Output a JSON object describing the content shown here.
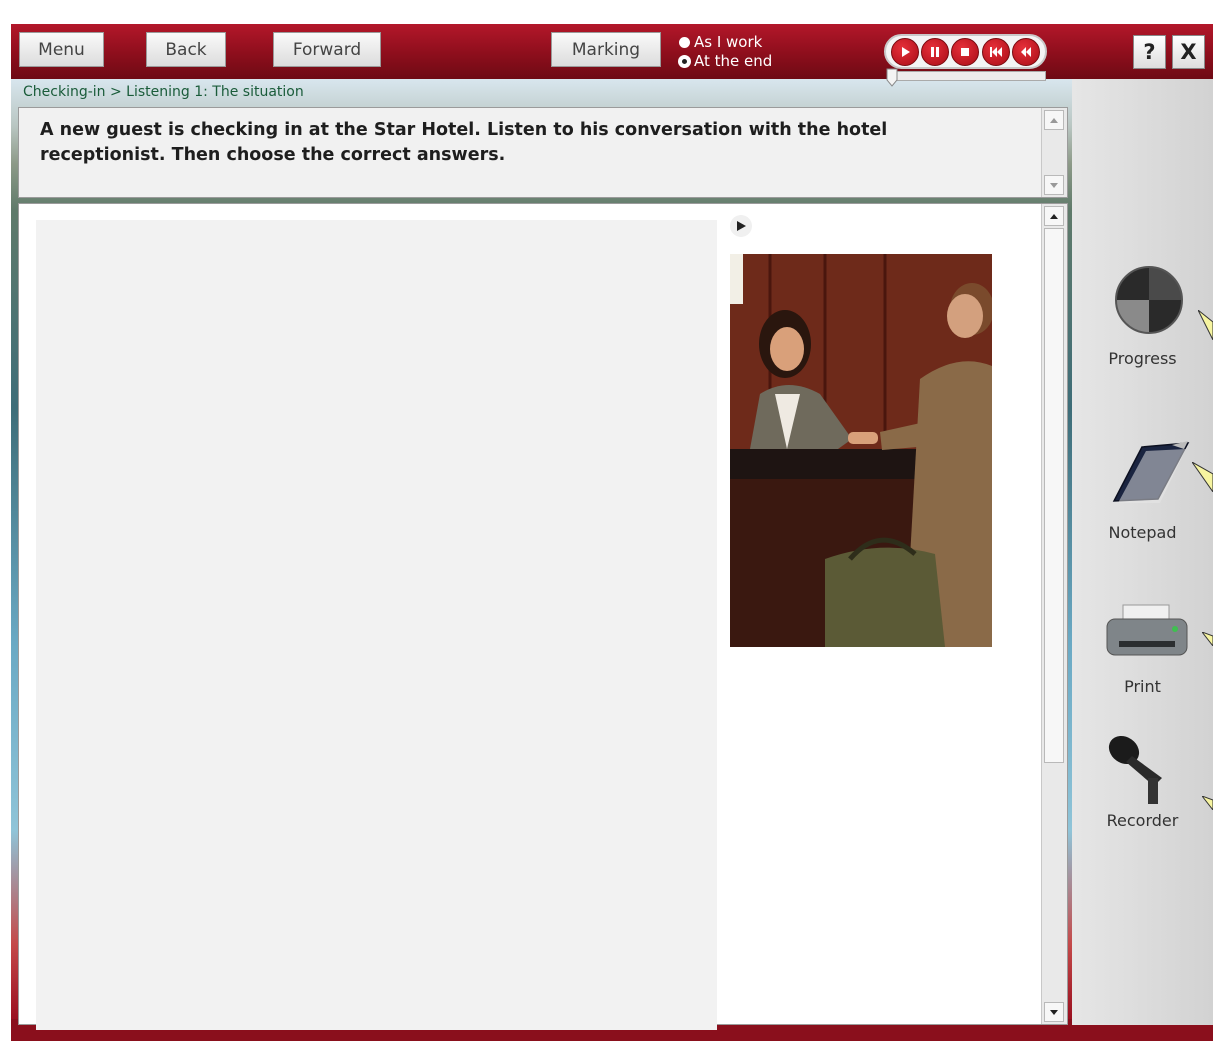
{
  "toolbar": {
    "menu_label": "Menu",
    "back_label": "Back",
    "forward_label": "Forward",
    "marking_label": "Marking",
    "marking_options": [
      {
        "label": "As I work",
        "selected": false
      },
      {
        "label": "At the end",
        "selected": true
      }
    ],
    "media_controls": [
      "play-icon",
      "pause-icon",
      "stop-icon",
      "rewind-icon",
      "skip-back-icon"
    ],
    "help_label": "?",
    "close_label": "X"
  },
  "breadcrumb": "Checking-in > Listening 1: The situation",
  "instructions": "A new guest is checking in at the Star Hotel. Listen to his conversation with the hotel receptionist. Then choose the correct answers.",
  "sidebar": {
    "progress_label": "Progress",
    "notepad_label": "Notepad",
    "print_label": "Print",
    "recorder_label": "Recorder"
  },
  "colors": {
    "brand_red": "#8d0e1c",
    "accent_red": "#d6232f",
    "panel_gray": "#f2f2f2"
  }
}
